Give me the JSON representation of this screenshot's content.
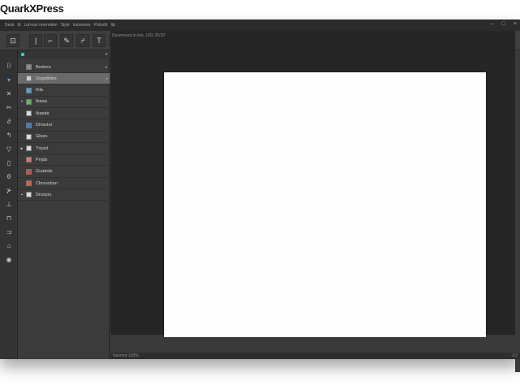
{
  "app": {
    "title": "QuarkXPress"
  },
  "menubar": {
    "items": [
      "Desk",
      "Ib",
      "Lorrnan norrnmlen",
      "Slyle",
      "Iransnnes",
      "Pohsdlr",
      "Ilp"
    ],
    "window_controls": [
      "–",
      "□",
      "×"
    ]
  },
  "toolbar": {
    "tools": [
      {
        "icon": "document-icon",
        "glyph": "⊡"
      },
      {
        "icon": "line-icon",
        "glyph": "|"
      },
      {
        "icon": "crop-icon",
        "glyph": "⌐"
      },
      {
        "icon": "pen-icon",
        "glyph": "✎"
      },
      {
        "icon": "brush-icon",
        "glyph": "⌿"
      },
      {
        "icon": "type-icon",
        "glyph": "T"
      },
      {
        "icon": "pencil-icon",
        "glyph": "✐"
      },
      {
        "icon": "picture-icon",
        "glyph": "▬"
      },
      {
        "icon": "grid-icon",
        "glyph": "⊞"
      },
      {
        "icon": "layout-icon",
        "glyph": "⊟"
      },
      {
        "icon": "glasses-icon",
        "glyph": "∞"
      },
      {
        "icon": "table-icon",
        "glyph": "▦"
      },
      {
        "icon": "hand-icon",
        "glyph": "✋"
      },
      {
        "icon": "zoom-icon",
        "glyph": "⊕"
      },
      {
        "icon": "target-icon",
        "glyph": "◎"
      },
      {
        "icon": "shield-icon",
        "glyph": "♡"
      }
    ]
  },
  "left_tools": [
    {
      "icon": "item-tool-icon",
      "glyph": "⌷"
    },
    {
      "icon": "select-icon",
      "glyph": "▾",
      "blue": true
    },
    {
      "icon": "x-icon",
      "glyph": "✕"
    },
    {
      "icon": "scissors-icon",
      "glyph": "✂"
    },
    {
      "icon": "link-icon",
      "glyph": "∂"
    },
    {
      "icon": "rotate-icon",
      "glyph": "↰"
    },
    {
      "icon": "triangle-icon",
      "glyph": "▽"
    },
    {
      "icon": "box-icon",
      "glyph": "▯"
    },
    {
      "icon": "oval-icon",
      "glyph": "θ"
    },
    {
      "icon": "star-icon",
      "glyph": "⊁"
    },
    {
      "icon": "column-icon",
      "glyph": "⊥"
    },
    {
      "icon": "flag-icon",
      "glyph": "⊓"
    },
    {
      "icon": "frame-icon",
      "glyph": "⊐"
    },
    {
      "icon": "lock-icon",
      "glyph": "⌂"
    },
    {
      "icon": "eye-icon",
      "glyph": "◉"
    }
  ],
  "panel": {
    "rows": [
      {
        "label": "Bodvnn",
        "bullet": "",
        "thumb": "#8a8a8a",
        "arrow": "▸",
        "selected": false
      },
      {
        "label": "Dsgotblies",
        "bullet": "",
        "thumb": "#cfcfcf",
        "arrow": "◂",
        "selected": true
      },
      {
        "label": "Ihla",
        "bullet": "",
        "thumb": "#4aa3e0",
        "arrow": "",
        "selected": false
      },
      {
        "label": "Ibeaa",
        "bullet": "▪",
        "thumb": "#52c052",
        "arrow": "",
        "selected": false
      },
      {
        "label": "Ibaxde",
        "bullet": "",
        "thumb": "#dcdcdc",
        "arrow": "",
        "selected": false
      },
      {
        "label": "Dmsstor",
        "bullet": "",
        "thumb": "#3a7ed0",
        "arrow": "",
        "selected": false
      },
      {
        "label": "Gtxes",
        "bullet": "",
        "thumb": "#dcdcdc",
        "arrow": "",
        "selected": false
      },
      {
        "label": "Tnysd",
        "bullet": "▸",
        "thumb": "#dcdcdc",
        "arrow": "",
        "selected": false
      },
      {
        "label": "Prrjds",
        "bullet": "",
        "thumb": "#e07070",
        "arrow": "",
        "selected": false
      },
      {
        "label": "Guadols",
        "bullet": "",
        "thumb": "#d04a4a",
        "arrow": "",
        "selected": false
      },
      {
        "label": "Cbrsuobon",
        "bullet": "",
        "thumb": "#e05a3a",
        "arrow": "",
        "selected": false
      },
      {
        "label": "Drsoprs",
        "bullet": "▪",
        "thumb": "#dcdcdc",
        "arrow": "",
        "selected": false
      }
    ]
  },
  "canvas": {
    "info": "Dosmeuna to ilas. 100, 20/20"
  },
  "status": {
    "zoom": "Nenmnt 100%",
    "page": "1/2"
  }
}
